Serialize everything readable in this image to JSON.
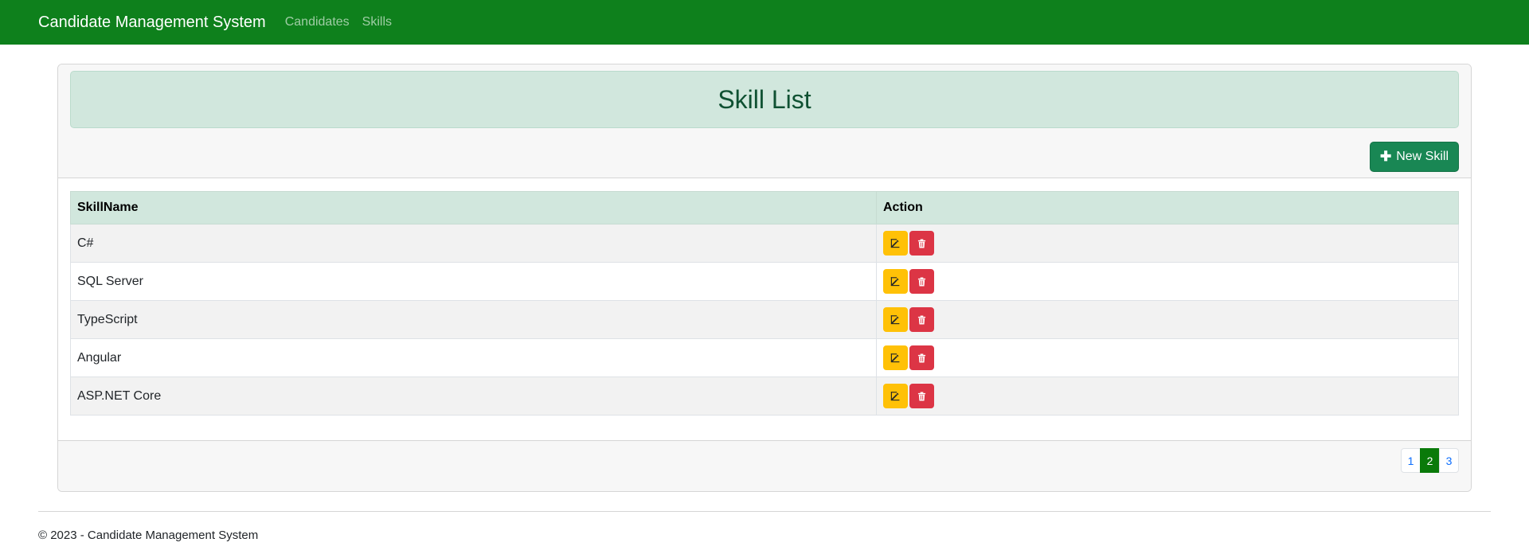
{
  "navbar": {
    "brand": "Candidate Management System",
    "links": [
      "Candidates",
      "Skills"
    ]
  },
  "page": {
    "title": "Skill List",
    "new_button": "New Skill"
  },
  "table": {
    "headers": [
      "SkillName",
      "Action"
    ],
    "rows": [
      "C#",
      "SQL Server",
      "TypeScript",
      "Angular",
      "ASP.NET Core"
    ]
  },
  "pagination": {
    "pages": [
      "1",
      "2",
      "3"
    ],
    "current": "2"
  },
  "footer": {
    "text": "© 2023 - Candidate Management System"
  },
  "colors": {
    "navbar": "#0e801c",
    "edit": "#ffc107",
    "delete": "#dc3545",
    "header_bg": "#d1e7dd"
  }
}
